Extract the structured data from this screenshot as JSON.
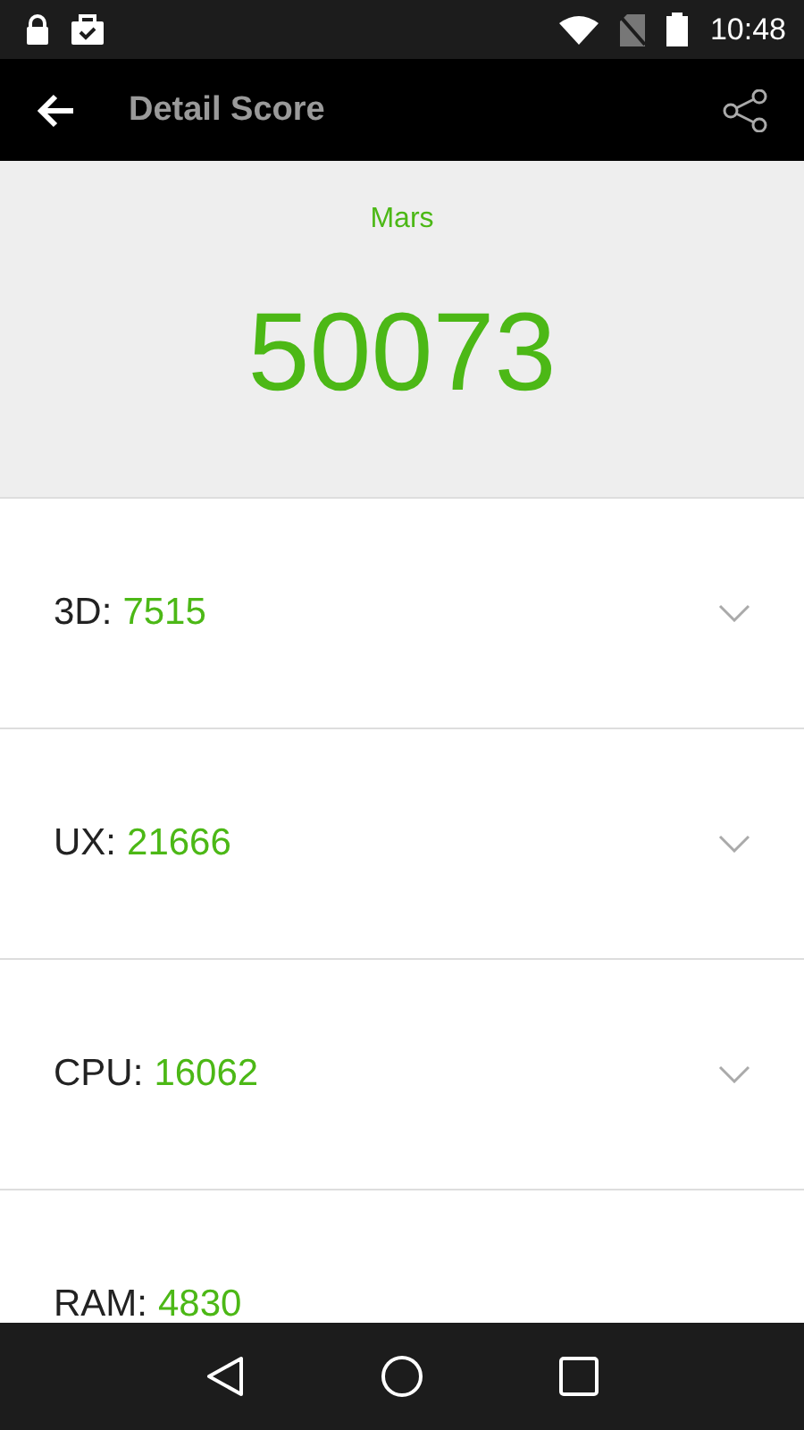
{
  "status_bar": {
    "time": "10:48"
  },
  "app_bar": {
    "title": "Detail Score"
  },
  "summary": {
    "device": "Mars",
    "score": "50073"
  },
  "scores": [
    {
      "label": "3D:",
      "value": "7515",
      "expandable": true
    },
    {
      "label": "UX:",
      "value": "21666",
      "expandable": true
    },
    {
      "label": "CPU:",
      "value": "16062",
      "expandable": true
    },
    {
      "label": "RAM:",
      "value": "4830",
      "expandable": false
    }
  ]
}
